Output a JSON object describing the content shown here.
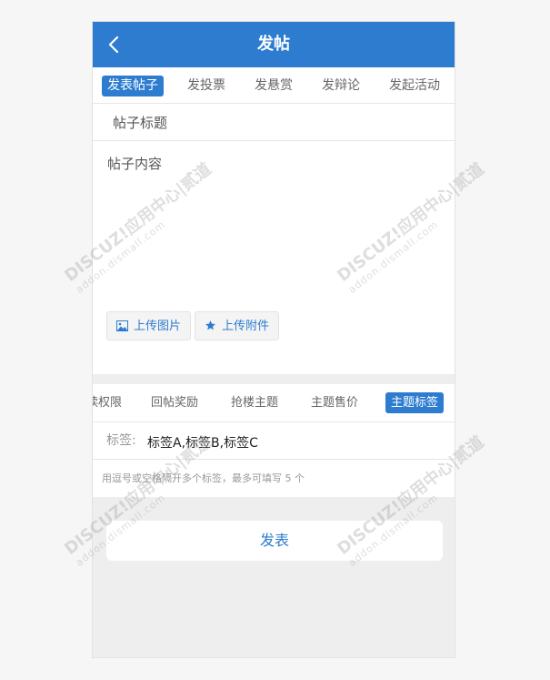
{
  "header": {
    "title": "发帖",
    "back_icon": "chevron-left-icon"
  },
  "post_types": [
    {
      "label": "发表帖子",
      "active": true
    },
    {
      "label": "发投票",
      "active": false
    },
    {
      "label": "发悬赏",
      "active": false
    },
    {
      "label": "发辩论",
      "active": false
    },
    {
      "label": "发起活动",
      "active": false
    }
  ],
  "form": {
    "title_placeholder": "帖子标题",
    "content_placeholder": "帖子内容",
    "upload_image_label": "上传图片",
    "upload_attachment_label": "上传附件"
  },
  "options": [
    {
      "label": "阅读权限",
      "active": false
    },
    {
      "label": "回帖奖励",
      "active": false
    },
    {
      "label": "抢楼主题",
      "active": false
    },
    {
      "label": "主题售价",
      "active": false
    },
    {
      "label": "主题标签",
      "active": true
    }
  ],
  "tags": {
    "label": "标签:",
    "value": "标签A,标签B,标签C",
    "hint": "用逗号或空格隔开多个标签，最多可填写 5 个"
  },
  "submit_label": "发表",
  "watermark": {
    "main": "DISCUZ!应用中心|贰道",
    "sub": "addon.dismall.com"
  },
  "colors": {
    "accent": "#2d7cd0",
    "background": "#eeeeee"
  }
}
